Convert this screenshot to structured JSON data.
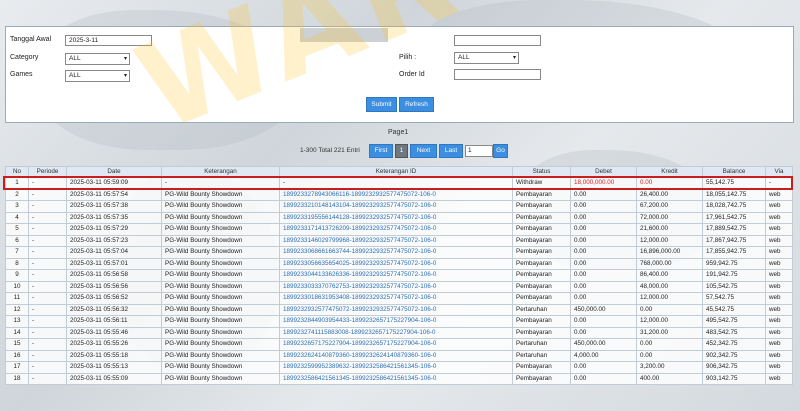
{
  "filters": {
    "tanggal_awal_label": "Tanggal Awal",
    "tanggal_awal_value": "2025-3-11",
    "category_label": "Category",
    "category_value": "ALL",
    "games_label": "Games",
    "games_value": "ALL",
    "pilih_label": "Pilih :",
    "pilih_value": "ALL",
    "order_id_label": "Order Id",
    "order_id_value": "",
    "submit_label": "Submit",
    "refresh_label": "Refresh"
  },
  "pager": {
    "title": "Page1",
    "info": "1-300 Total 221 Entri",
    "first": "First",
    "current": "1",
    "next": "Next",
    "last": "Last",
    "input_value": "1",
    "go": "Go"
  },
  "table": {
    "headers": [
      "No",
      "Periode",
      "Date",
      "Keterangan",
      "Keterangan ID",
      "Status",
      "Debet",
      "Kredit",
      "Balance",
      "Via"
    ],
    "rows": [
      [
        "1",
        "-",
        "2025-03-11 05:59:09",
        "-",
        "-",
        "Withdraw",
        "18,000,000.00",
        "0.00",
        "55,142.75",
        "-"
      ],
      [
        "2",
        "-",
        "2025-03-11 05:57:54",
        "PG-Wild Bounty Showdown",
        "1899233278943066116-1899232932577475072-106-0",
        "Pembayaran",
        "0.00",
        "26,400.00",
        "18,055,142.75",
        "web"
      ],
      [
        "3",
        "-",
        "2025-03-11 05:57:38",
        "PG-Wild Bounty Showdown",
        "1899233210148143104-1899232932577475072-106-0",
        "Pembayaran",
        "0.00",
        "67,200.00",
        "18,028,742.75",
        "web"
      ],
      [
        "4",
        "-",
        "2025-03-11 05:57:35",
        "PG-Wild Bounty Showdown",
        "1899233195556144128-1899232932577475072-106-0",
        "Pembayaran",
        "0.00",
        "72,000.00",
        "17,961,542.75",
        "web"
      ],
      [
        "5",
        "-",
        "2025-03-11 05:57:29",
        "PG-Wild Bounty Showdown",
        "1899233171413726209-1899232932577475072-106-0",
        "Pembayaran",
        "0.00",
        "21,600.00",
        "17,889,542.75",
        "web"
      ],
      [
        "6",
        "-",
        "2025-03-11 05:57:23",
        "PG-Wild Bounty Showdown",
        "1899233146029799968-1899232932577475072-106-0",
        "Pembayaran",
        "0.00",
        "12,000.00",
        "17,867,942.75",
        "web"
      ],
      [
        "7",
        "-",
        "2025-03-11 05:57:04",
        "PG-Wild Bounty Showdown",
        "1899233068661663744-1899232932577475072-106-0",
        "Pembayaran",
        "0.00",
        "16,896,000.00",
        "17,855,942.75",
        "web"
      ],
      [
        "8",
        "-",
        "2025-03-11 05:57:01",
        "PG-Wild Bounty Showdown",
        "1899233056635654025-1899232932577475072-106-0",
        "Pembayaran",
        "0.00",
        "768,000.00",
        "959,942.75",
        "web"
      ],
      [
        "9",
        "-",
        "2025-03-11 05:56:58",
        "PG-Wild Bounty Showdown",
        "1899233044133626336-1899232932577475072-106-0",
        "Pembayaran",
        "0.00",
        "86,400.00",
        "191,942.75",
        "web"
      ],
      [
        "10",
        "-",
        "2025-03-11 05:56:56",
        "PG-Wild Bounty Showdown",
        "1899233033370762753-1899232932577475072-106-0",
        "Pembayaran",
        "0.00",
        "48,000.00",
        "105,542.75",
        "web"
      ],
      [
        "11",
        "-",
        "2025-03-11 05:56:52",
        "PG-Wild Bounty Showdown",
        "1899233018631953408-1899232932577475072-106-0",
        "Pembayaran",
        "0.00",
        "12,000.00",
        "57,542.75",
        "web"
      ],
      [
        "12",
        "-",
        "2025-03-11 05:56:32",
        "PG-Wild Bounty Showdown",
        "1899232932577475072-1899232932577475072-106-0",
        "Pertaruhan",
        "450,000.00",
        "0.00",
        "45,542.75",
        "web"
      ],
      [
        "13",
        "-",
        "2025-03-11 05:56:11",
        "PG-Wild Bounty Showdown",
        "1899232844903954433-1899232657175227904-106-0",
        "Pembayaran",
        "0.00",
        "12,000.00",
        "495,542.75",
        "web"
      ],
      [
        "14",
        "-",
        "2025-03-11 05:55:46",
        "PG-Wild Bounty Showdown",
        "1899232741115883008-1899232657175227904-106-0",
        "Pembayaran",
        "0.00",
        "31,200.00",
        "483,542.75",
        "web"
      ],
      [
        "15",
        "-",
        "2025-03-11 05:55:26",
        "PG-Wild Bounty Showdown",
        "1899232657175227904-1899232657175227904-106-0",
        "Pertaruhan",
        "450,000.00",
        "0.00",
        "452,342.75",
        "web"
      ],
      [
        "16",
        "-",
        "2025-03-11 05:55:18",
        "PG-Wild Bounty Showdown",
        "1899232624140879360-1899232624140879360-106-0",
        "Pertaruhan",
        "4,000.00",
        "0.00",
        "902,342.75",
        "web"
      ],
      [
        "17",
        "-",
        "2025-03-11 05:55:13",
        "PG-Wild Bounty Showdown",
        "1899232599952389632-1899232586421561345-106-0",
        "Pembayaran",
        "0.00",
        "3,200.00",
        "906,342.75",
        "web"
      ],
      [
        "18",
        "-",
        "2025-03-11 05:55:09",
        "PG-Wild Bounty Showdown",
        "1899232586421561345-1899232586421561345-106-0",
        "Pembayaran",
        "0.00",
        "400.00",
        "903,142.75",
        "web"
      ]
    ]
  },
  "watermark_text": "WARTAWK",
  "colors": {
    "accent": "#3c8ee0",
    "highlight_border": "#c81e1e",
    "link": "#2a6fb5",
    "negative": "#e02020"
  }
}
